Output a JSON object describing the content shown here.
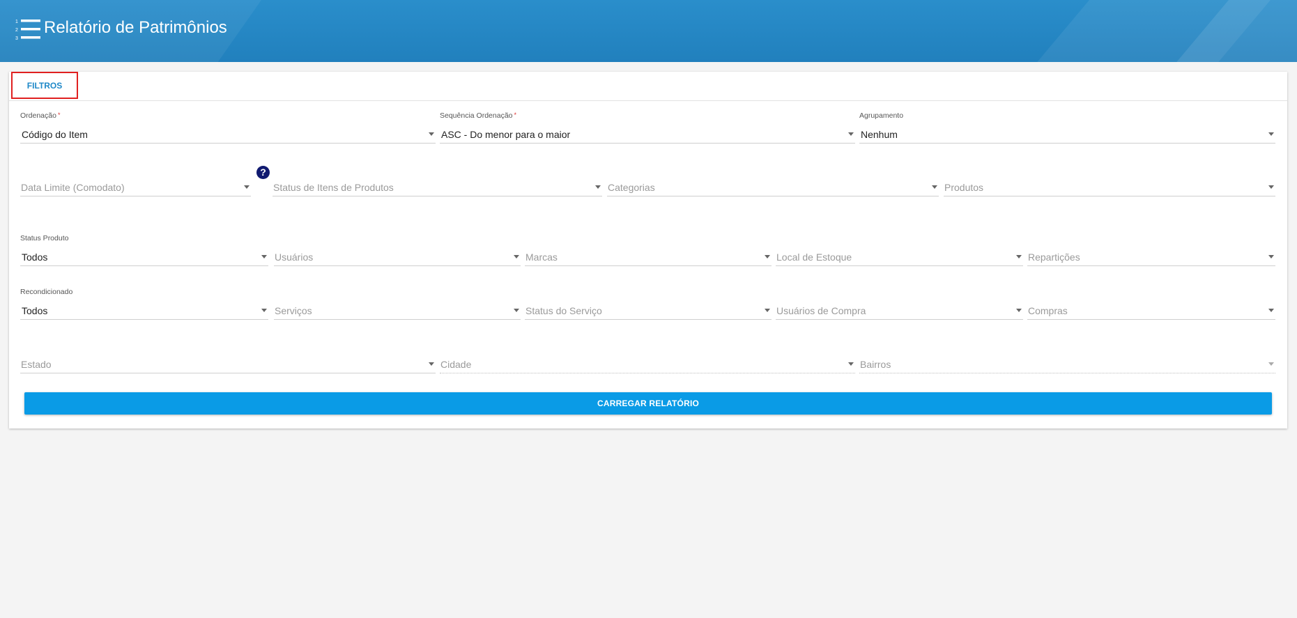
{
  "header": {
    "title": "Relatório de Patrimônios",
    "icon": "numbered-list-icon"
  },
  "tabs": [
    {
      "label": "FILTROS"
    }
  ],
  "filters": {
    "row1": [
      {
        "label": "Ordenação",
        "required": "*",
        "value": "Código do Item"
      },
      {
        "label": "Sequência Ordenação",
        "required": "*",
        "value": "ASC - Do menor para o maior"
      },
      {
        "label": "Agrupamento",
        "value": "Nenhum"
      }
    ],
    "row2": [
      {
        "placeholder": "Data Limite (Comodato)"
      },
      {
        "placeholder": "Status de Itens de Produtos"
      },
      {
        "placeholder": "Categorias"
      },
      {
        "placeholder": "Produtos"
      }
    ],
    "help_icon": "?",
    "row3": [
      {
        "label": "Status Produto",
        "value": "Todos"
      },
      {
        "placeholder": "Usuários"
      },
      {
        "placeholder": "Marcas"
      },
      {
        "placeholder": "Local de Estoque"
      },
      {
        "placeholder": "Repartições"
      }
    ],
    "row4": [
      {
        "label": "Recondicionado",
        "value": "Todos"
      },
      {
        "placeholder": "Serviços"
      },
      {
        "placeholder": "Status do Serviço"
      },
      {
        "placeholder": "Usuários de Compra"
      },
      {
        "placeholder": "Compras"
      }
    ],
    "row5": [
      {
        "placeholder": "Estado"
      },
      {
        "placeholder": "Cidade"
      },
      {
        "placeholder": "Bairros"
      }
    ]
  },
  "actions": {
    "load_report": "CARREGAR RELATÓRIO"
  },
  "colors": {
    "header": "#2180bd",
    "accent": "#0a9be6",
    "tab_highlight": "#e02020",
    "help_icon": "#101a70"
  }
}
